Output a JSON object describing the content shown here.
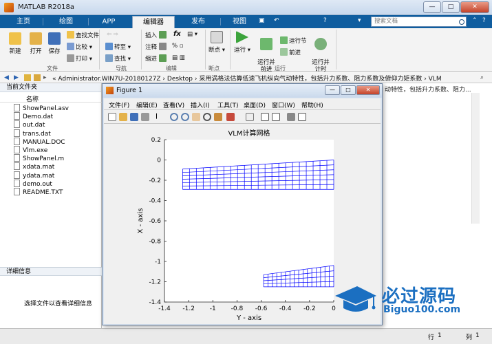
{
  "window": {
    "title": "MATLAB R2018a",
    "minimize": "—",
    "maximize": "□",
    "close": "✕"
  },
  "tabs": [
    {
      "label": "主页"
    },
    {
      "label": "绘图"
    },
    {
      "label": "APP"
    },
    {
      "label": "编辑器"
    },
    {
      "label": "发布"
    },
    {
      "label": "视图"
    }
  ],
  "search": {
    "placeholder": "搜索文档"
  },
  "ribbon": {
    "file": {
      "new": "新建",
      "open": "打开",
      "save": "保存",
      "find_files": "查找文件",
      "compare": "比较",
      "print": "打印",
      "group": "文件"
    },
    "nav": {
      "goto": "转至",
      "find": "查找",
      "group": "导航"
    },
    "edit": {
      "insert": "插入",
      "comment": "注释",
      "indent": "缩进",
      "fx": "fx",
      "group": "编辑"
    },
    "breakpoints": {
      "label": "断点",
      "group": "断点"
    },
    "run": {
      "run": "运行",
      "run_advance": "运行并\n前进",
      "run_section": "运行节",
      "advance": "前进",
      "run_time": "运行并\n计时",
      "group": "运行"
    }
  },
  "address": {
    "path": "« Administrator.WIN7U-20180127Z  ›  Desktop  ›  采用涡格法估算低速飞机纵向气动特性，包括升力系数、阻力系数及俯仰力矩系数  ›  VLM"
  },
  "left_panel": {
    "header": "当前文件夹",
    "column": "名称",
    "files": [
      "ShowPanel.asv",
      "Demo.dat",
      "out.dat",
      "trans.dat",
      "MANUAL.DOC",
      "Vlm.exe",
      "ShowPanel.m",
      "xdata.mat",
      "ydata.mat",
      "demo.out",
      "README.TXT"
    ],
    "detail_header": "详细信息",
    "detail_msg": "选择文件以查看详细信息"
  },
  "right_panel": {
    "text": "动特性，包括升力系数、阻力..."
  },
  "status": {
    "row_label": "行",
    "row": "1",
    "col_label": "列",
    "col": "1"
  },
  "figure": {
    "title": "Figure 1",
    "menus": [
      "文件(F)",
      "编辑(E)",
      "查看(V)",
      "插入(I)",
      "工具(T)",
      "桌面(D)",
      "窗口(W)",
      "帮助(H)"
    ]
  },
  "chart_data": {
    "type": "line",
    "title": "VLM计算网格",
    "xlabel": "Y - axis",
    "ylabel": "X - axis",
    "xlim": [
      -1.4,
      0
    ],
    "ylim": [
      -1.4,
      0.2
    ],
    "xticks": [
      "-1.4",
      "-1.2",
      "-1",
      "-0.8",
      "-0.6",
      "-0.4",
      "-0.2",
      "0"
    ],
    "yticks": [
      "0.2",
      "0",
      "-0.2",
      "-0.4",
      "-0.6",
      "-0.8",
      "-1",
      "-1.2",
      "-1.4"
    ],
    "grid": false,
    "color": "#0000ff",
    "series": [
      {
        "chordwise_panels": 6,
        "spanwise_panels": 22,
        "le": [
          [
            -1.25,
            -0.09
          ],
          [
            0,
            0
          ]
        ],
        "te": [
          [
            -1.25,
            -0.29
          ],
          [
            0,
            -0.29
          ]
        ]
      },
      {
        "chordwise_panels": 4,
        "spanwise_panels": 16,
        "le": [
          [
            -0.58,
            -1.13
          ],
          [
            0,
            -1.04
          ]
        ],
        "te": [
          [
            -0.58,
            -1.25
          ],
          [
            0,
            -1.25
          ]
        ]
      }
    ]
  },
  "watermark": {
    "title": "必过源码",
    "url": "Biguo100.com"
  }
}
